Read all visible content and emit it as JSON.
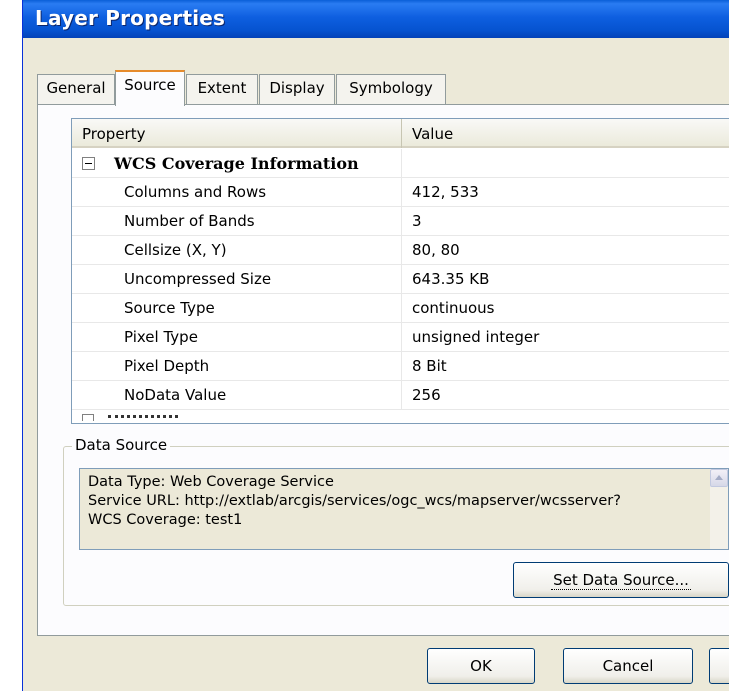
{
  "window": {
    "title": "Layer Properties"
  },
  "tabs": [
    {
      "label": "General"
    },
    {
      "label": "Source"
    },
    {
      "label": "Extent"
    },
    {
      "label": "Display"
    },
    {
      "label": "Symbology"
    }
  ],
  "active_tab": "Source",
  "grid": {
    "headers": {
      "property": "Property",
      "value": "Value"
    },
    "group": {
      "label": "WCS Coverage Information",
      "expanded": true
    },
    "rows": [
      {
        "property": "Columns and Rows",
        "value": "412, 533"
      },
      {
        "property": "Number of Bands",
        "value": "3"
      },
      {
        "property": "Cellsize (X, Y)",
        "value": "80, 80"
      },
      {
        "property": "Uncompressed Size",
        "value": "643.35 KB"
      },
      {
        "property": "Source Type",
        "value": "continuous"
      },
      {
        "property": "Pixel Type",
        "value": "unsigned integer"
      },
      {
        "property": "Pixel Depth",
        "value": "8 Bit"
      },
      {
        "property": "NoData Value",
        "value": "256"
      }
    ]
  },
  "data_source": {
    "legend": "Data Source",
    "lines": [
      "Data Type: Web Coverage Service",
      "Service URL: http://extlab/arcgis/services/ogc_wcs/mapserver/wcsserver?",
      "WCS Coverage: test1"
    ],
    "set_button": "Set Data Source..."
  },
  "buttons": {
    "ok": "OK",
    "cancel": "Cancel"
  },
  "colors": {
    "title_bar": "#0653d0",
    "dialog_face": "#ece9d8",
    "active_tab_accent": "#e68b2c"
  }
}
